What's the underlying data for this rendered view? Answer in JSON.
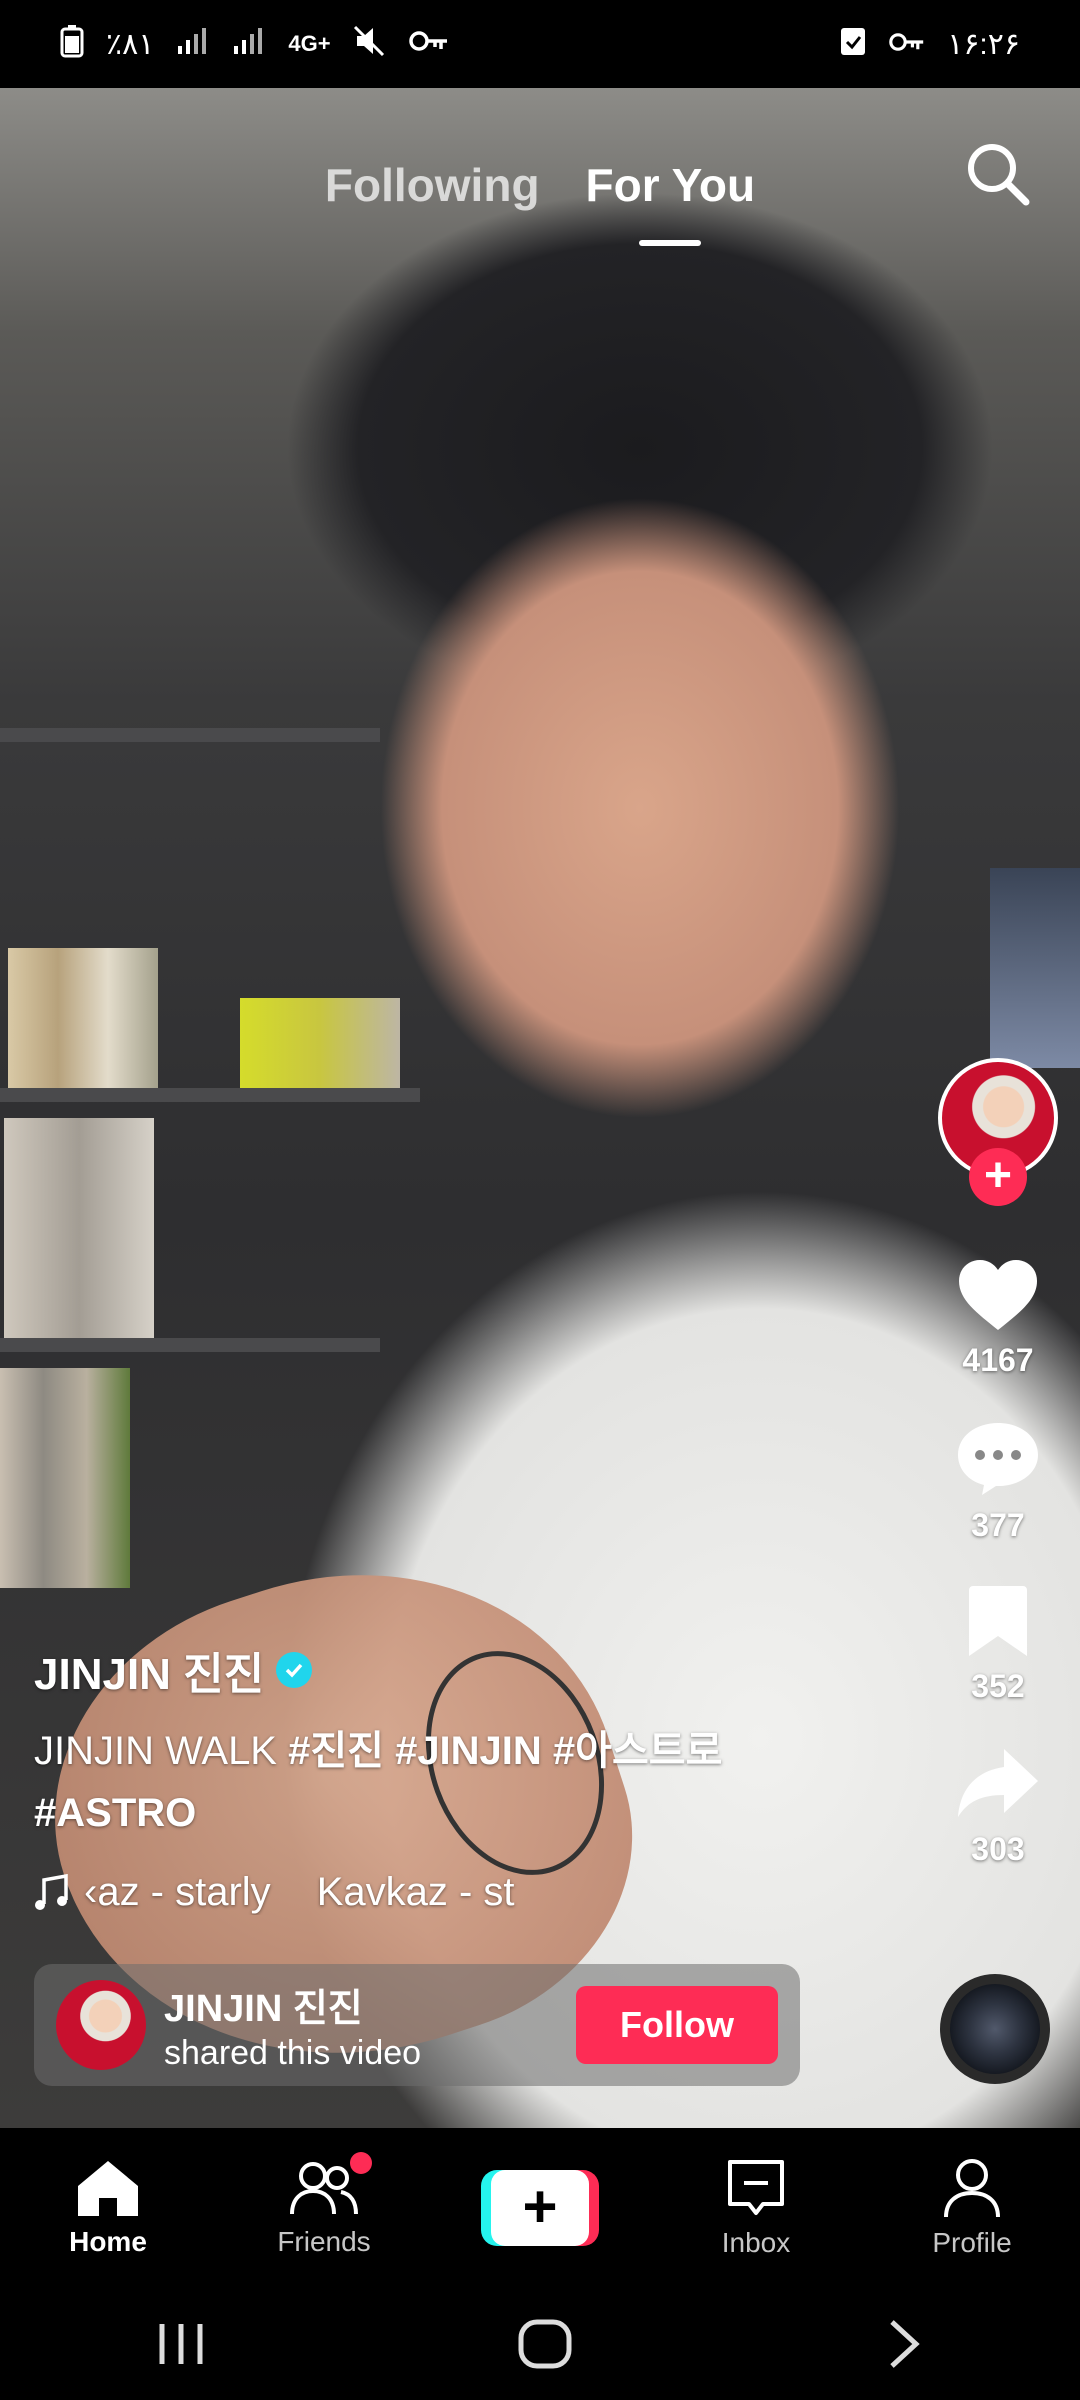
{
  "status_bar": {
    "battery_text": "٪۸۱",
    "network": "4G+",
    "time": "۱۶:۲۶"
  },
  "top_tabs": {
    "following": "Following",
    "for_you": "For You"
  },
  "actions": {
    "likes": "4167",
    "comments": "377",
    "saves": "352",
    "shares": "303"
  },
  "caption": {
    "author": "JINJIN 진진",
    "description_plain": "JINJIN WALK ",
    "description_tags": "#진진 #JINJIN #아스트로 #ASTRO",
    "music_a": "‹az - starly",
    "music_b": "Kavkaz - st"
  },
  "share_card": {
    "name": "JINJIN 진진",
    "subtitle": "shared this video",
    "follow_label": "Follow"
  },
  "bottom_nav": {
    "home": "Home",
    "friends": "Friends",
    "create": "+",
    "inbox": "Inbox",
    "profile": "Profile"
  },
  "colors": {
    "accent": "#fe2c55",
    "cyan": "#25f4ee",
    "verified": "#20d5ec"
  }
}
